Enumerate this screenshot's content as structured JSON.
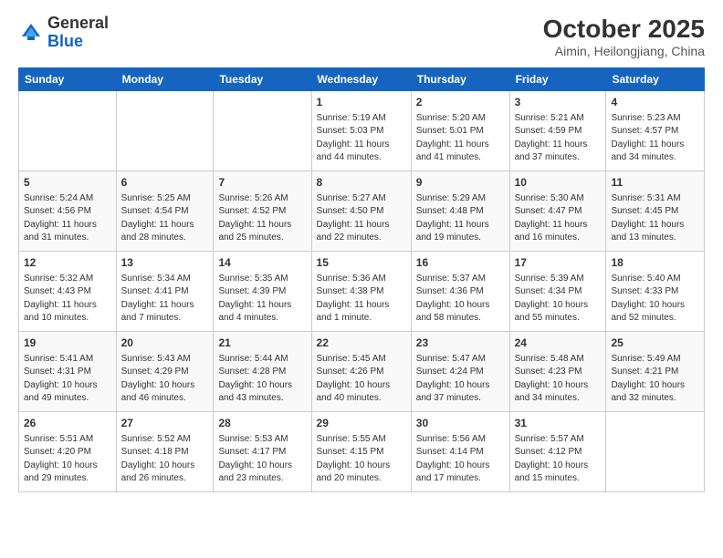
{
  "header": {
    "logo_general": "General",
    "logo_blue": "Blue",
    "month": "October 2025",
    "location": "Aimin, Heilongjiang, China"
  },
  "days_of_week": [
    "Sunday",
    "Monday",
    "Tuesday",
    "Wednesday",
    "Thursday",
    "Friday",
    "Saturday"
  ],
  "weeks": [
    [
      {
        "day": "",
        "info": ""
      },
      {
        "day": "",
        "info": ""
      },
      {
        "day": "",
        "info": ""
      },
      {
        "day": "1",
        "info": "Sunrise: 5:19 AM\nSunset: 5:03 PM\nDaylight: 11 hours\nand 44 minutes."
      },
      {
        "day": "2",
        "info": "Sunrise: 5:20 AM\nSunset: 5:01 PM\nDaylight: 11 hours\nand 41 minutes."
      },
      {
        "day": "3",
        "info": "Sunrise: 5:21 AM\nSunset: 4:59 PM\nDaylight: 11 hours\nand 37 minutes."
      },
      {
        "day": "4",
        "info": "Sunrise: 5:23 AM\nSunset: 4:57 PM\nDaylight: 11 hours\nand 34 minutes."
      }
    ],
    [
      {
        "day": "5",
        "info": "Sunrise: 5:24 AM\nSunset: 4:56 PM\nDaylight: 11 hours\nand 31 minutes."
      },
      {
        "day": "6",
        "info": "Sunrise: 5:25 AM\nSunset: 4:54 PM\nDaylight: 11 hours\nand 28 minutes."
      },
      {
        "day": "7",
        "info": "Sunrise: 5:26 AM\nSunset: 4:52 PM\nDaylight: 11 hours\nand 25 minutes."
      },
      {
        "day": "8",
        "info": "Sunrise: 5:27 AM\nSunset: 4:50 PM\nDaylight: 11 hours\nand 22 minutes."
      },
      {
        "day": "9",
        "info": "Sunrise: 5:29 AM\nSunset: 4:48 PM\nDaylight: 11 hours\nand 19 minutes."
      },
      {
        "day": "10",
        "info": "Sunrise: 5:30 AM\nSunset: 4:47 PM\nDaylight: 11 hours\nand 16 minutes."
      },
      {
        "day": "11",
        "info": "Sunrise: 5:31 AM\nSunset: 4:45 PM\nDaylight: 11 hours\nand 13 minutes."
      }
    ],
    [
      {
        "day": "12",
        "info": "Sunrise: 5:32 AM\nSunset: 4:43 PM\nDaylight: 11 hours\nand 10 minutes."
      },
      {
        "day": "13",
        "info": "Sunrise: 5:34 AM\nSunset: 4:41 PM\nDaylight: 11 hours\nand 7 minutes."
      },
      {
        "day": "14",
        "info": "Sunrise: 5:35 AM\nSunset: 4:39 PM\nDaylight: 11 hours\nand 4 minutes."
      },
      {
        "day": "15",
        "info": "Sunrise: 5:36 AM\nSunset: 4:38 PM\nDaylight: 11 hours\nand 1 minute."
      },
      {
        "day": "16",
        "info": "Sunrise: 5:37 AM\nSunset: 4:36 PM\nDaylight: 10 hours\nand 58 minutes."
      },
      {
        "day": "17",
        "info": "Sunrise: 5:39 AM\nSunset: 4:34 PM\nDaylight: 10 hours\nand 55 minutes."
      },
      {
        "day": "18",
        "info": "Sunrise: 5:40 AM\nSunset: 4:33 PM\nDaylight: 10 hours\nand 52 minutes."
      }
    ],
    [
      {
        "day": "19",
        "info": "Sunrise: 5:41 AM\nSunset: 4:31 PM\nDaylight: 10 hours\nand 49 minutes."
      },
      {
        "day": "20",
        "info": "Sunrise: 5:43 AM\nSunset: 4:29 PM\nDaylight: 10 hours\nand 46 minutes."
      },
      {
        "day": "21",
        "info": "Sunrise: 5:44 AM\nSunset: 4:28 PM\nDaylight: 10 hours\nand 43 minutes."
      },
      {
        "day": "22",
        "info": "Sunrise: 5:45 AM\nSunset: 4:26 PM\nDaylight: 10 hours\nand 40 minutes."
      },
      {
        "day": "23",
        "info": "Sunrise: 5:47 AM\nSunset: 4:24 PM\nDaylight: 10 hours\nand 37 minutes."
      },
      {
        "day": "24",
        "info": "Sunrise: 5:48 AM\nSunset: 4:23 PM\nDaylight: 10 hours\nand 34 minutes."
      },
      {
        "day": "25",
        "info": "Sunrise: 5:49 AM\nSunset: 4:21 PM\nDaylight: 10 hours\nand 32 minutes."
      }
    ],
    [
      {
        "day": "26",
        "info": "Sunrise: 5:51 AM\nSunset: 4:20 PM\nDaylight: 10 hours\nand 29 minutes."
      },
      {
        "day": "27",
        "info": "Sunrise: 5:52 AM\nSunset: 4:18 PM\nDaylight: 10 hours\nand 26 minutes."
      },
      {
        "day": "28",
        "info": "Sunrise: 5:53 AM\nSunset: 4:17 PM\nDaylight: 10 hours\nand 23 minutes."
      },
      {
        "day": "29",
        "info": "Sunrise: 5:55 AM\nSunset: 4:15 PM\nDaylight: 10 hours\nand 20 minutes."
      },
      {
        "day": "30",
        "info": "Sunrise: 5:56 AM\nSunset: 4:14 PM\nDaylight: 10 hours\nand 17 minutes."
      },
      {
        "day": "31",
        "info": "Sunrise: 5:57 AM\nSunset: 4:12 PM\nDaylight: 10 hours\nand 15 minutes."
      },
      {
        "day": "",
        "info": ""
      }
    ]
  ]
}
